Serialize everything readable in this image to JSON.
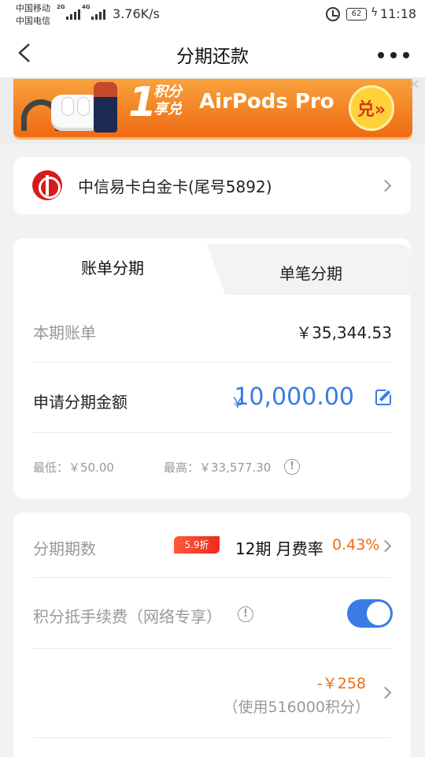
{
  "status_bar": {
    "carrier1": "中国移动",
    "carrier2": "中国电信",
    "net1": "2G",
    "net2": "4G",
    "speed": "3.76K/s",
    "battery": "62",
    "time": "11:18"
  },
  "nav": {
    "title": "分期还款",
    "back_icon": "chevron-left-icon",
    "more_icon": "more-dots-icon"
  },
  "banner": {
    "points_digit": "1",
    "points_text_line1": "积分",
    "points_text_line2": "享兑",
    "product": "AirPods Pro",
    "exchange_button": "兑»",
    "close": "×"
  },
  "card": {
    "name": "中信易卡白金卡(尾号5892)"
  },
  "tabs": [
    {
      "label": "账单分期",
      "active": true
    },
    {
      "label": "单笔分期",
      "active": false
    }
  ],
  "bill": {
    "current_label": "本期账单",
    "current_amount": "￥35,344.53",
    "apply_label": "申请分期金额",
    "currency": "￥",
    "apply_amount": "10,000.00",
    "min_label": "最低：￥50.00",
    "max_label": "最高：￥33,577.30"
  },
  "installment": {
    "periods_label": "分期期数",
    "discount_badge": "5.9折",
    "period_value": "12期 月费率",
    "rate": "0.43%",
    "points_fee_label": "积分抵手续费（网络专享）",
    "toggle_on": true,
    "deduction": "-￥258",
    "points_used": "（使用516000积分）"
  },
  "colors": {
    "accent_blue": "#3a7ce4",
    "accent_orange": "#f06b18",
    "brand_red": "#d71a1a"
  }
}
